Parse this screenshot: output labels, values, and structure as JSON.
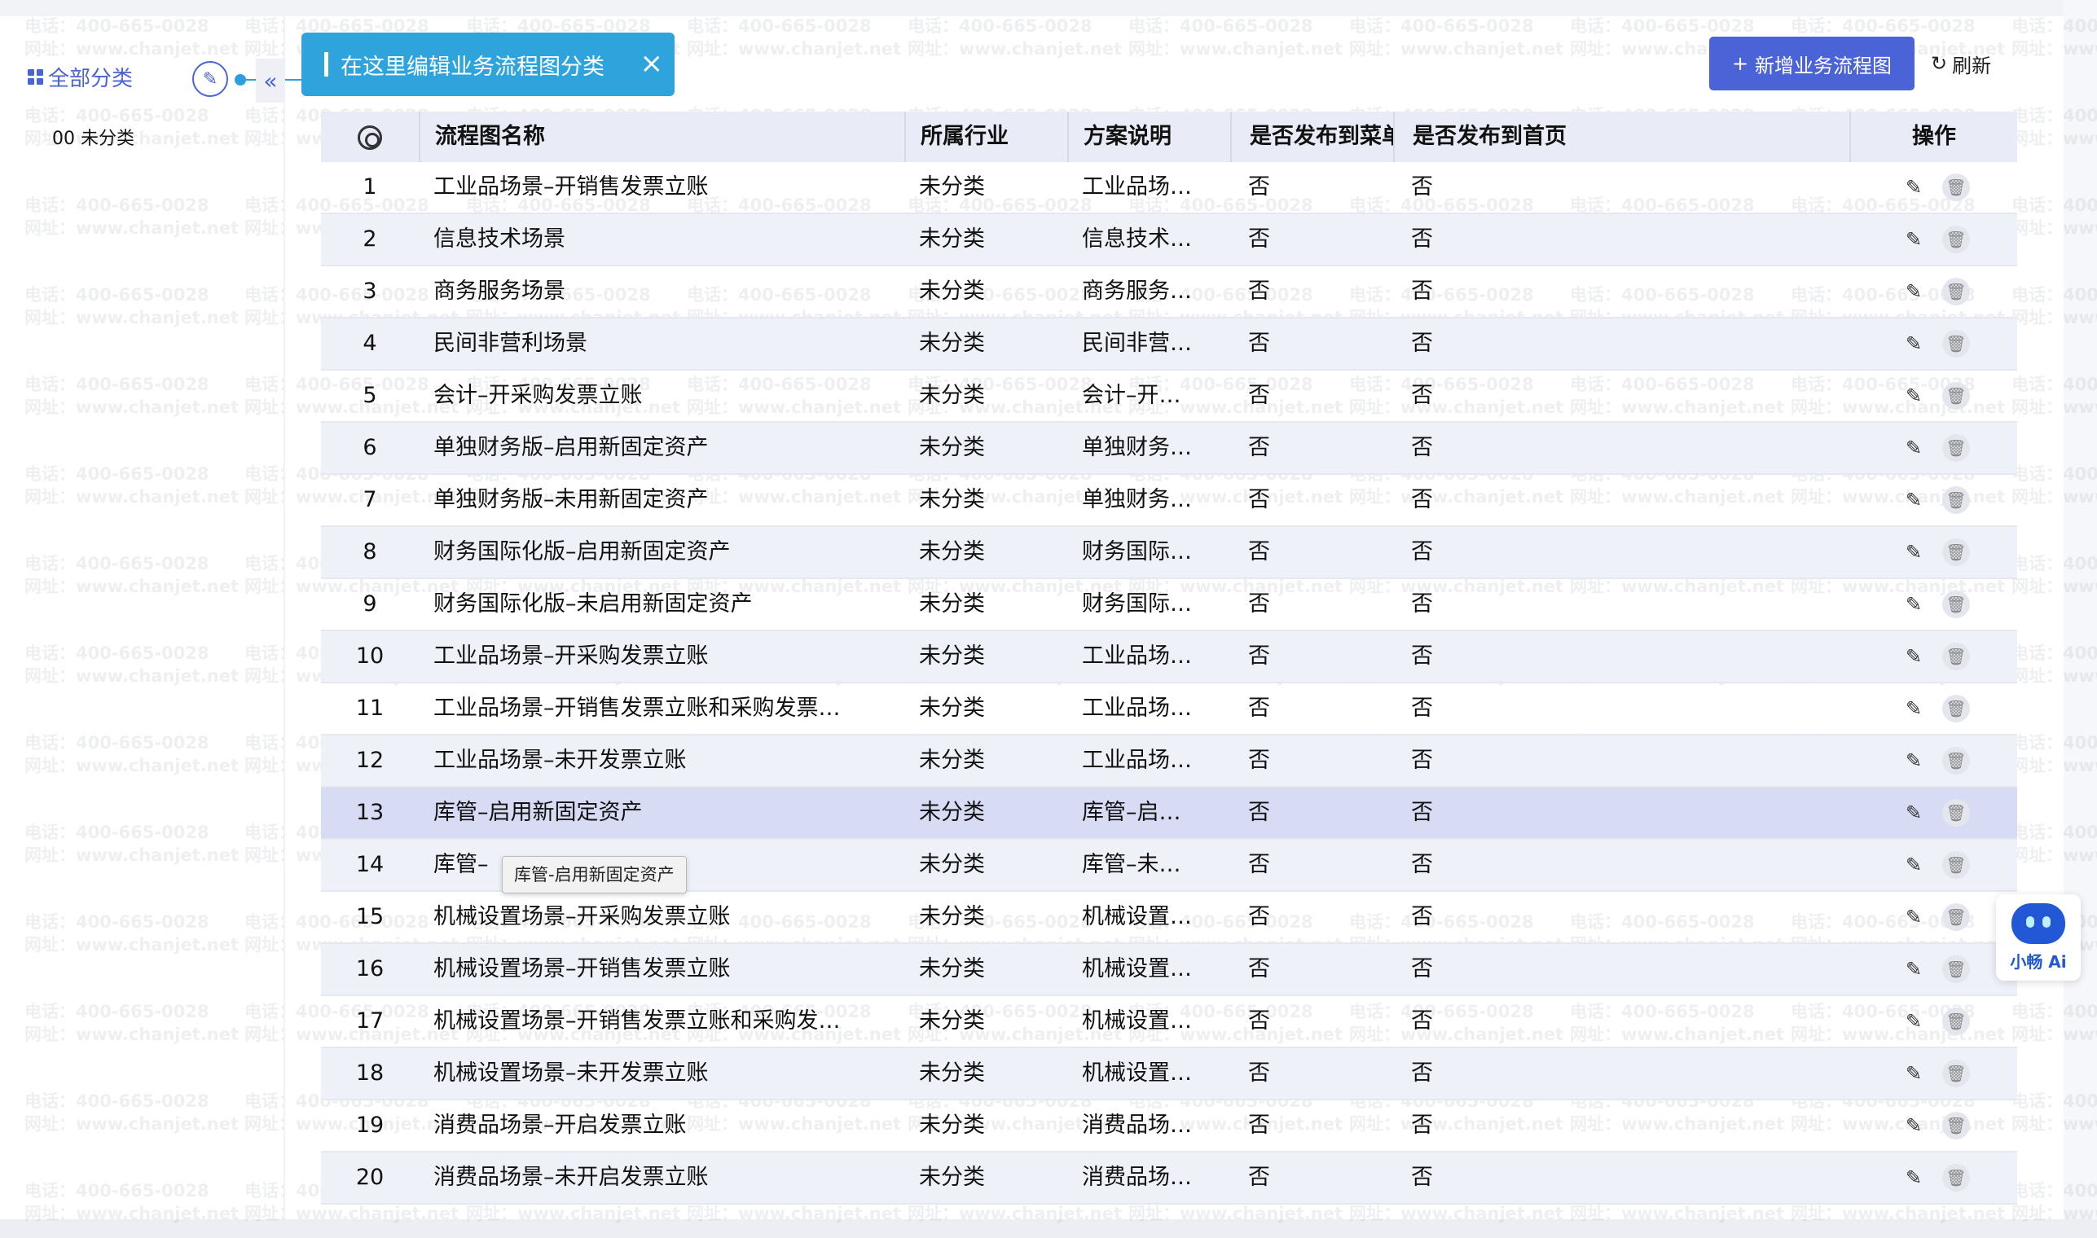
{
  "sidebar": {
    "all_categories_label": "全部分类",
    "collapse_icon": "«",
    "category_item": "00 未分类"
  },
  "tip": {
    "text": "在这里编辑业务流程图分类",
    "close": "×"
  },
  "toolbar": {
    "add_label": "新增业务流程图",
    "add_icon": "+",
    "refresh_label": "刷新",
    "refresh_icon": "↻"
  },
  "table": {
    "headers": {
      "name": "流程图名称",
      "industry": "所属行业",
      "desc": "方案说明",
      "menu": "是否发布到菜单",
      "home": "是否发布到首页",
      "ops": "操作"
    },
    "rows": [
      {
        "no": "1",
        "name": "工业品场景–开销售发票立账",
        "industry": "未分类",
        "desc": "工业品场…",
        "menu": "否",
        "home": "否"
      },
      {
        "no": "2",
        "name": "信息技术场景",
        "industry": "未分类",
        "desc": "信息技术…",
        "menu": "否",
        "home": "否"
      },
      {
        "no": "3",
        "name": "商务服务场景",
        "industry": "未分类",
        "desc": "商务服务…",
        "menu": "否",
        "home": "否"
      },
      {
        "no": "4",
        "name": "民间非营利场景",
        "industry": "未分类",
        "desc": "民间非营…",
        "menu": "否",
        "home": "否"
      },
      {
        "no": "5",
        "name": "会计–开采购发票立账",
        "industry": "未分类",
        "desc": "会计–开…",
        "menu": "否",
        "home": "否"
      },
      {
        "no": "6",
        "name": "单独财务版–启用新固定资产",
        "industry": "未分类",
        "desc": "单独财务…",
        "menu": "否",
        "home": "否"
      },
      {
        "no": "7",
        "name": "单独财务版–未用新固定资产",
        "industry": "未分类",
        "desc": "单独财务…",
        "menu": "否",
        "home": "否"
      },
      {
        "no": "8",
        "name": "财务国际化版–启用新固定资产",
        "industry": "未分类",
        "desc": "财务国际…",
        "menu": "否",
        "home": "否"
      },
      {
        "no": "9",
        "name": "财务国际化版–未启用新固定资产",
        "industry": "未分类",
        "desc": "财务国际…",
        "menu": "否",
        "home": "否"
      },
      {
        "no": "10",
        "name": "工业品场景–开采购发票立账",
        "industry": "未分类",
        "desc": "工业品场…",
        "menu": "否",
        "home": "否"
      },
      {
        "no": "11",
        "name": "工业品场景–开销售发票立账和采购发票…",
        "industry": "未分类",
        "desc": "工业品场…",
        "menu": "否",
        "home": "否"
      },
      {
        "no": "12",
        "name": "工业品场景–未开发票立账",
        "industry": "未分类",
        "desc": "工业品场…",
        "menu": "否",
        "home": "否"
      },
      {
        "no": "13",
        "name": "库管–启用新固定资产",
        "industry": "未分类",
        "desc": "库管–启…",
        "menu": "否",
        "home": "否"
      },
      {
        "no": "14",
        "name": "库管–",
        "industry": "未分类",
        "desc": "库管–未…",
        "menu": "否",
        "home": "否"
      },
      {
        "no": "15",
        "name": "机械设置场景–开采购发票立账",
        "industry": "未分类",
        "desc": "机械设置…",
        "menu": "否",
        "home": "否"
      },
      {
        "no": "16",
        "name": "机械设置场景–开销售发票立账",
        "industry": "未分类",
        "desc": "机械设置…",
        "menu": "否",
        "home": "否"
      },
      {
        "no": "17",
        "name": "机械设置场景–开销售发票立账和采购发…",
        "industry": "未分类",
        "desc": "机械设置…",
        "menu": "否",
        "home": "否"
      },
      {
        "no": "18",
        "name": "机械设置场景–未开发票立账",
        "industry": "未分类",
        "desc": "机械设置…",
        "menu": "否",
        "home": "否"
      },
      {
        "no": "19",
        "name": "消费品场景–开启发票立账",
        "industry": "未分类",
        "desc": "消费品场…",
        "menu": "否",
        "home": "否"
      },
      {
        "no": "20",
        "name": "消费品场景–未开启发票立账",
        "industry": "未分类",
        "desc": "消费品场…",
        "menu": "否",
        "home": "否"
      }
    ],
    "highlighted_row": "13"
  },
  "tooltip": "库管-启用新固定资产",
  "assistant": {
    "label": "小畅 Ai"
  },
  "watermark": {
    "phone": "电话：400-665-0028",
    "site": "网址：www.chanjet.net"
  },
  "colors": {
    "accent": "#4a63d6",
    "tip": "#2fa4dc",
    "header_bg": "#e9ecf7",
    "highlight": "#d7dcf4"
  }
}
